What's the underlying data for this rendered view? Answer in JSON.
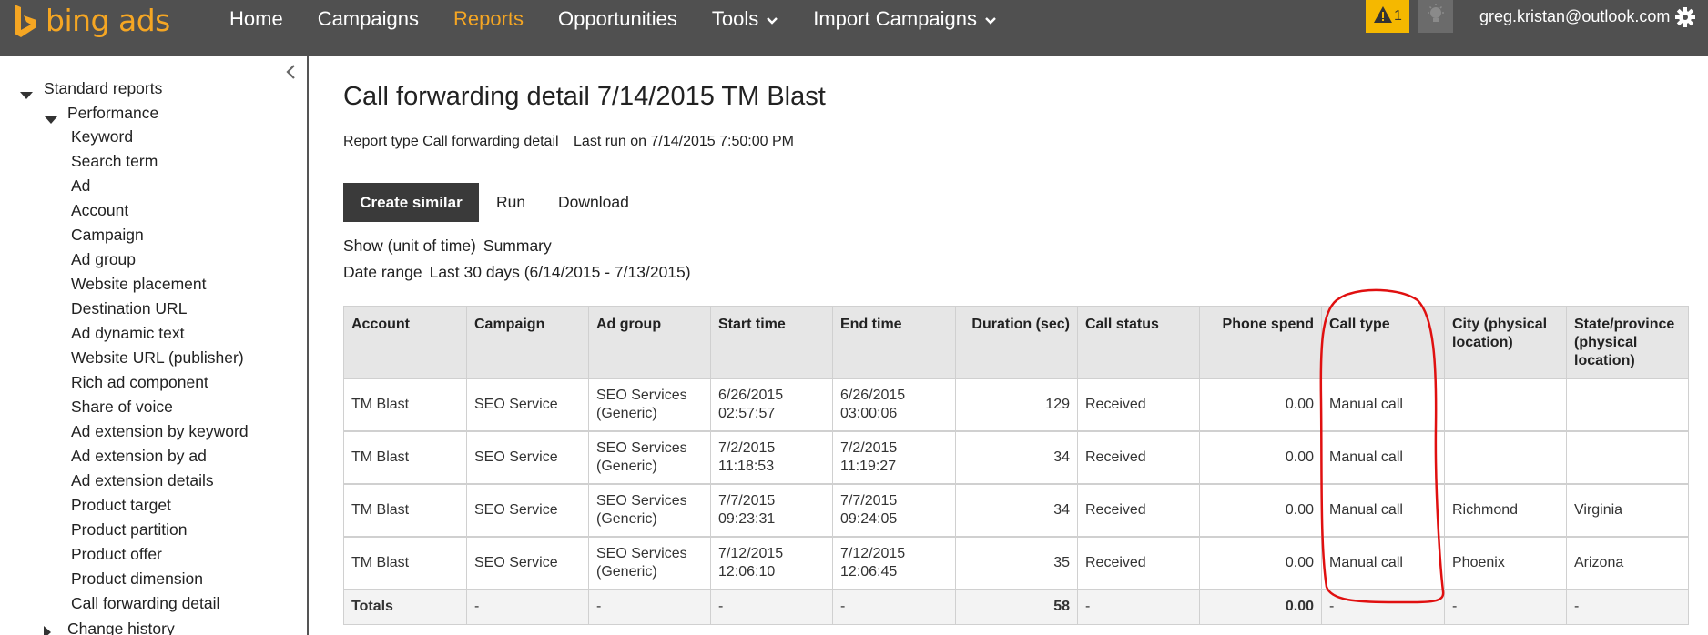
{
  "header": {
    "logo_text": "bing ads",
    "nav": [
      {
        "label": "Home",
        "dropdown": false
      },
      {
        "label": "Campaigns",
        "dropdown": false
      },
      {
        "label": "Reports",
        "dropdown": false,
        "active": true
      },
      {
        "label": "Opportunities",
        "dropdown": false
      },
      {
        "label": "Tools",
        "dropdown": true
      },
      {
        "label": "Import Campaigns",
        "dropdown": true
      }
    ],
    "alert_count": "1",
    "user_email": "greg.kristan@outlook.com",
    "icons": [
      "warning-icon",
      "lightbulb-icon",
      "gear-icon"
    ],
    "colors": {
      "bar": "#505050",
      "accent": "#f5a623",
      "alert": "#f5b800"
    }
  },
  "sidebar": {
    "root": {
      "label": "Standard reports",
      "expanded": true
    },
    "group": {
      "label": "Performance",
      "expanded": true
    },
    "items": [
      "Keyword",
      "Search term",
      "Ad",
      "Account",
      "Campaign",
      "Ad group",
      "Website placement",
      "Destination URL",
      "Ad dynamic text",
      "Website URL (publisher)",
      "Rich ad component",
      "Share of voice",
      "Ad extension by keyword",
      "Ad extension by ad",
      "Ad extension details",
      "Product target",
      "Product partition",
      "Product offer",
      "Product dimension",
      "Call forwarding detail"
    ],
    "collapsed_group": {
      "label": "Change history",
      "expanded": false
    }
  },
  "main": {
    "title": "Call forwarding detail 7/14/2015 TM Blast",
    "report_type": "Report type Call forwarding detail",
    "last_run": "Last run on 7/14/2015 7:50:00 PM",
    "buttons": {
      "create_similar": "Create similar",
      "run": "Run",
      "download": "Download"
    },
    "show_label": "Show (unit of time)",
    "show_value": "Summary",
    "range_label": "Date range",
    "range_value": "Last 30 days (6/14/2015 - 7/13/2015)"
  },
  "table": {
    "columns": [
      {
        "label": "Account",
        "align": "left"
      },
      {
        "label": "Campaign",
        "align": "left"
      },
      {
        "label": "Ad group",
        "align": "left"
      },
      {
        "label": "Start time",
        "align": "left"
      },
      {
        "label": "End time",
        "align": "left"
      },
      {
        "label": "Duration (sec)",
        "align": "right"
      },
      {
        "label": "Call status",
        "align": "left"
      },
      {
        "label": "Phone spend",
        "align": "right"
      },
      {
        "label": "Call type",
        "align": "left"
      },
      {
        "label": "City (physical location)",
        "align": "left"
      },
      {
        "label": "State/province (physical location)",
        "align": "left"
      }
    ],
    "rows": [
      [
        "TM Blast",
        "SEO Service",
        "SEO Services (Generic)",
        "6/26/2015 02:57:57",
        "6/26/2015 03:00:06",
        "129",
        "Received",
        "0.00",
        "Manual call",
        "",
        ""
      ],
      [
        "TM Blast",
        "SEO Service",
        "SEO Services (Generic)",
        "7/2/2015 11:18:53",
        "7/2/2015 11:19:27",
        "34",
        "Received",
        "0.00",
        "Manual call",
        "",
        ""
      ],
      [
        "TM Blast",
        "SEO Service",
        "SEO Services (Generic)",
        "7/7/2015 09:23:31",
        "7/7/2015 09:24:05",
        "34",
        "Received",
        "0.00",
        "Manual call",
        "Richmond",
        "Virginia"
      ],
      [
        "TM Blast",
        "SEO Service",
        "SEO Services (Generic)",
        "7/12/2015 12:06:10",
        "7/12/2015 12:06:45",
        "35",
        "Received",
        "0.00",
        "Manual call",
        "Phoenix",
        "Arizona"
      ]
    ],
    "totals": [
      "Totals",
      "-",
      "-",
      "-",
      "-",
      "58",
      "-",
      "0.00",
      "-",
      "-",
      "-"
    ]
  },
  "annotation": {
    "target_column": "Call type",
    "color": "#e01010"
  }
}
